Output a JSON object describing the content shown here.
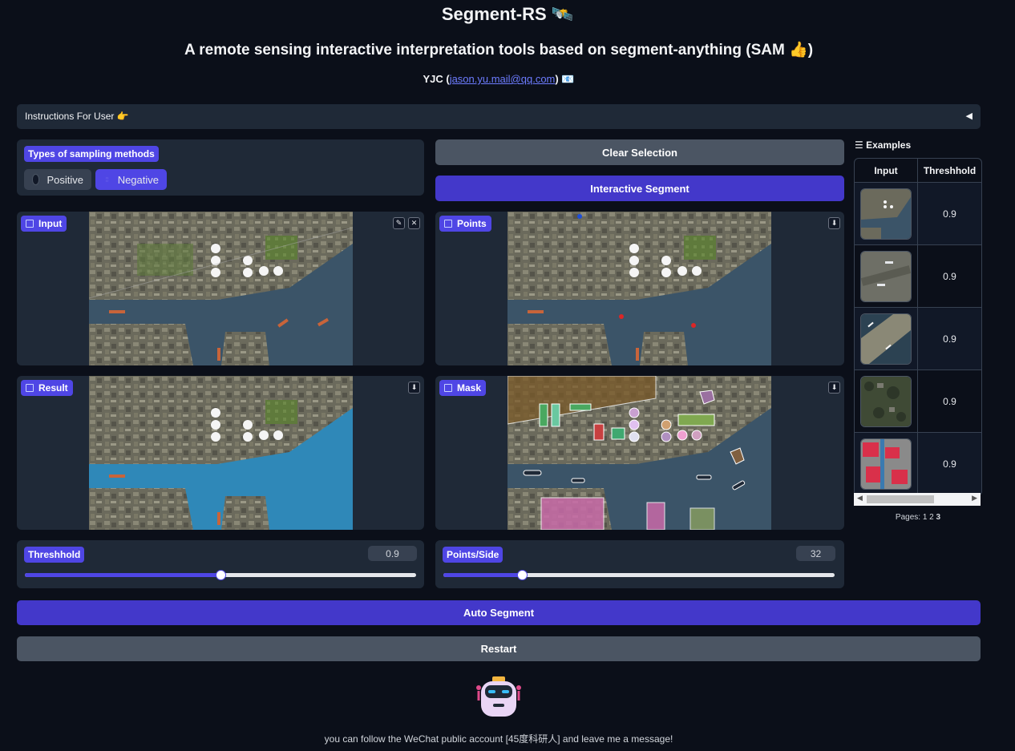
{
  "header": {
    "title": "Segment-RS 🛰️",
    "subtitle": "A remote sensing interactive interpretation tools based on segment-anything (SAM 👍)",
    "author_prefix": "YJC (",
    "author_email": "jason.yu.mail@qq.com",
    "author_suffix": ") 📧"
  },
  "instructions": {
    "label": "Instructions For User 👉",
    "toggle": "◀"
  },
  "sampling": {
    "label": "Types of sampling methods",
    "options": [
      {
        "label": "Positive",
        "selected": false
      },
      {
        "label": "Negative",
        "selected": true
      }
    ]
  },
  "buttons": {
    "clear_selection": "Clear Selection",
    "interactive_segment": "Interactive Segment",
    "auto_segment": "Auto Segment",
    "restart": "Restart"
  },
  "panels": {
    "input": "Input",
    "points": "Points",
    "result": "Result",
    "mask": "Mask"
  },
  "sliders": {
    "threshold": {
      "label": "Threshhold",
      "value": "0.9",
      "fraction": 0.5
    },
    "points_side": {
      "label": "Points/Side",
      "value": "32",
      "fraction": 0.2
    }
  },
  "examples": {
    "header": "☰ Examples",
    "columns": [
      "Input",
      "Threshhold"
    ],
    "rows": [
      {
        "threshold": "0.9"
      },
      {
        "threshold": "0.9"
      },
      {
        "threshold": "0.9"
      },
      {
        "threshold": "0.9"
      },
      {
        "threshold": "0.9"
      }
    ],
    "pages_label": "Pages:",
    "pages": [
      "1",
      "2",
      "3"
    ]
  },
  "footer": {
    "text": "you can follow the WeChat public account [45度科研人] and leave me a message!"
  },
  "colors": {
    "accent": "#4f46e5",
    "background": "#0b0f19",
    "panel": "#1f2937",
    "positive_point": "#1d4ed8",
    "negative_point": "#dc2626"
  }
}
